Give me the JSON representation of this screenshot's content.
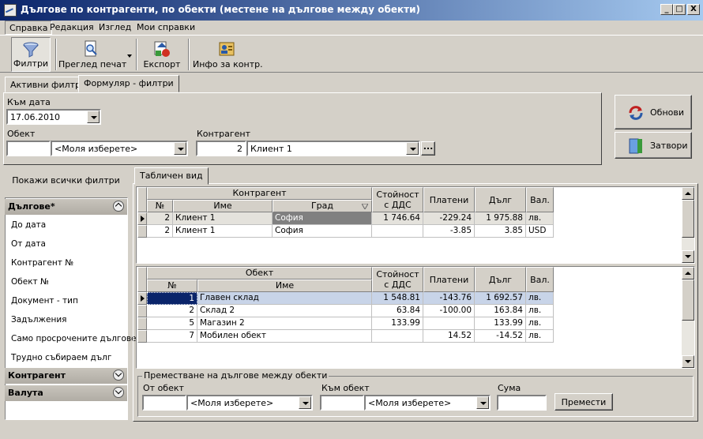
{
  "window": {
    "title": "Дългове по контрагенти, по обекти (местене на дългове между обекти)",
    "controls": {
      "minimize": "_",
      "maximize": "□",
      "close": "X"
    }
  },
  "menu": [
    "Справка",
    "Редакция",
    "Изглед",
    "Мои справки"
  ],
  "toolbar": {
    "filters": "Филтри",
    "print_preview": "Преглед печат",
    "export": "Експорт",
    "contractor_info": "Инфо за контр."
  },
  "filter_tabs": [
    "Активни филтри",
    "Формуляр - филтри"
  ],
  "form": {
    "to_date_label": "Към дата",
    "to_date_value": "17.06.2010",
    "object_label": "Обект",
    "object_code": "",
    "object_select": "<Моля изберете>",
    "contractor_label": "Контрагент",
    "contractor_code": "2",
    "contractor_select": "Клиент 1",
    "ellipsis": "..."
  },
  "actions": {
    "refresh": "Обнови",
    "close": "Затвори"
  },
  "sidebar": {
    "show_all": "Покажи всички филтри",
    "groups": [
      {
        "title": "Дългове*",
        "expanded": true,
        "items": [
          "До дата",
          "От дата",
          "Контрагент №",
          "Обект №",
          "Документ - тип",
          "Задължения",
          "Само просрочените дългове",
          "Трудно събираем дълг"
        ]
      },
      {
        "title": "Контрагент",
        "expanded": false,
        "items": []
      },
      {
        "title": "Валута",
        "expanded": false,
        "items": []
      }
    ]
  },
  "view_tab": "Табличен вид",
  "grid1": {
    "group_header": "Контрагент",
    "headers": [
      "№",
      "Име",
      "Град",
      "Стойност с ДДС",
      "Платени",
      "Дълг",
      "Вал."
    ],
    "rows": [
      [
        "2",
        "Клиент 1",
        "София",
        "1 746.64",
        "-229.24",
        "1 975.88",
        "лв."
      ],
      [
        "2",
        "Клиент 1",
        "София",
        "",
        "-3.85",
        "3.85",
        "USD"
      ]
    ]
  },
  "grid2": {
    "group_header": "Обект",
    "headers": [
      "№",
      "Име",
      "Стойност с ДДС",
      "Платени",
      "Дълг",
      "Вал."
    ],
    "rows": [
      [
        "1",
        "Главен склад",
        "1 548.81",
        "-143.76",
        "1 692.57",
        "лв."
      ],
      [
        "2",
        "Склад 2",
        "63.84",
        "-100.00",
        "163.84",
        "лв."
      ],
      [
        "5",
        "Магазин 2",
        "133.99",
        "",
        "133.99",
        "лв."
      ],
      [
        "7",
        "Мобилен обект",
        "",
        "14.52",
        "-14.52",
        "лв."
      ]
    ]
  },
  "move": {
    "title": "Преместване на дългове между обекти",
    "from_label": "От обект",
    "from_code": "",
    "from_select": "<Моля изберете>",
    "to_label": "Към обект",
    "to_code": "",
    "to_select": "<Моля изберете>",
    "amount_label": "Сума",
    "amount_value": "",
    "move_button": "Премести"
  },
  "colors": {
    "titlebar_start": "#0a246a",
    "titlebar_end": "#a6caf0",
    "selected_cell": "#0a246a",
    "selected_row": "#c8d4e8",
    "face": "#d4d0c8"
  }
}
